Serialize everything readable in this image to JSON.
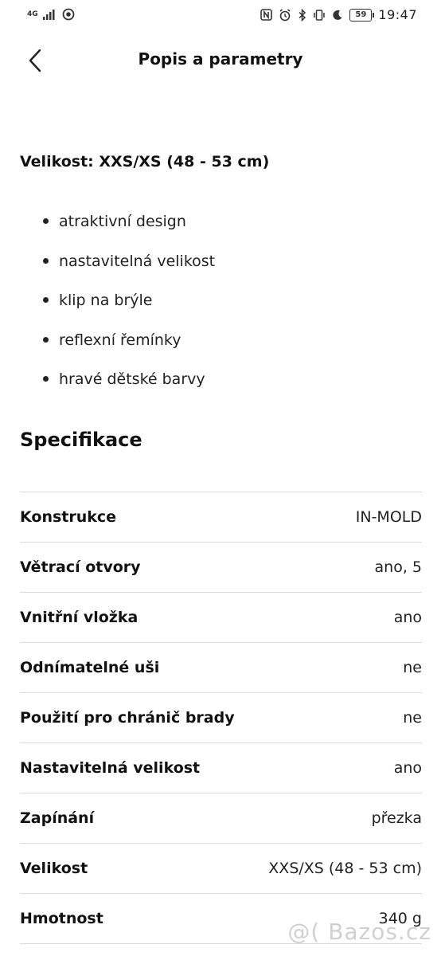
{
  "status_bar": {
    "network": "4G",
    "battery": "59",
    "time": "19:47",
    "left_icons": [
      "signal-icon",
      "camera-dot-icon"
    ],
    "right_icons": [
      "nfc-icon",
      "alarm-icon",
      "bluetooth-icon",
      "vibrate-icon",
      "moon-icon"
    ]
  },
  "header": {
    "back_icon": "chevron-left-icon",
    "title": "Popis a parametry"
  },
  "description": {
    "size_heading": "Velikost: XXS/XS (48 - 53 cm)",
    "features": [
      "atraktivní design",
      "nastavitelná velikost",
      "klip na brýle",
      "reflexní řemínky",
      "hravé dětské barvy"
    ]
  },
  "specs": {
    "title": "Specifikace",
    "rows": [
      {
        "label": "Konstrukce",
        "value": "IN-MOLD"
      },
      {
        "label": "Větrací otvory",
        "value": "ano, 5"
      },
      {
        "label": "Vnitřní vložka",
        "value": "ano"
      },
      {
        "label": "Odnímatelné uši",
        "value": "ne"
      },
      {
        "label": "Použití pro chránič brady",
        "value": "ne"
      },
      {
        "label": "Nastavitelná velikost",
        "value": "ano"
      },
      {
        "label": "Zapínání",
        "value": "přezka"
      },
      {
        "label": "Velikost",
        "value": "XXS/XS (48 - 53 cm)"
      },
      {
        "label": "Hmotnost",
        "value": "340 g"
      }
    ]
  },
  "watermark": "@( Bazos.cz"
}
